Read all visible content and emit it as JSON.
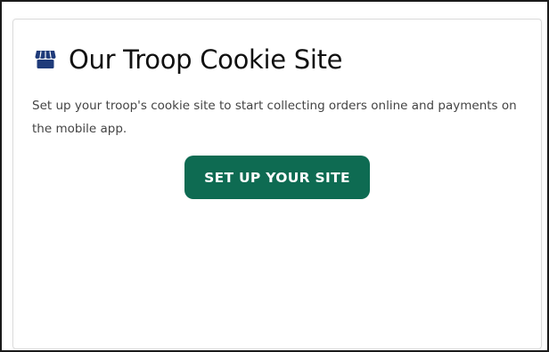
{
  "card": {
    "icon": "store-icon",
    "title": "Our Troop Cookie Site",
    "description": "Set up your troop's cookie site to start collecting orders online and payments on the mobile app.",
    "button_label": "SET UP YOUR SITE"
  },
  "colors": {
    "accent": "#0e6b52",
    "icon": "#1f3b7a",
    "title": "#111111",
    "text": "#444444"
  }
}
